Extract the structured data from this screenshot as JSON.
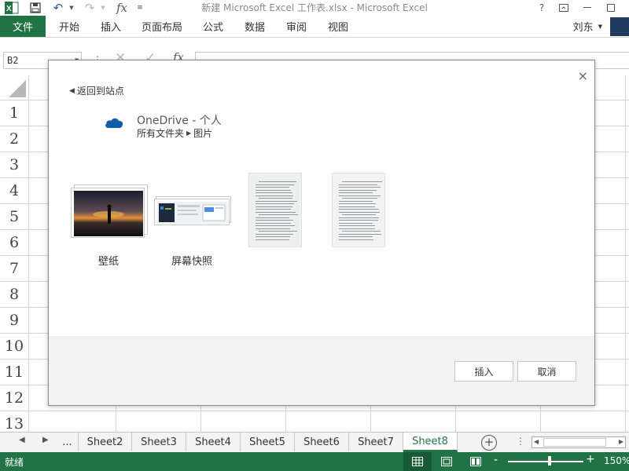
{
  "titlebar": {
    "title": "新建 Microsoft Excel 工作表.xlsx - Microsoft Excel",
    "help": "?",
    "fx": "fx"
  },
  "ribbon": {
    "file_tab": "文件",
    "tabs": [
      "开始",
      "插入",
      "页面布局",
      "公式",
      "数据",
      "审阅",
      "视图"
    ],
    "user_name": "刘东"
  },
  "formula_bar": {
    "name_box": "B2",
    "fx": "fx"
  },
  "grid": {
    "rows": [
      "1",
      "2",
      "3",
      "4",
      "5",
      "6",
      "7",
      "8",
      "9",
      "10",
      "11",
      "12",
      "13"
    ]
  },
  "dialog": {
    "back_link": "返回到站点",
    "service_name": "OneDrive - 个人",
    "path_root": "所有文件夹",
    "path_leaf": "图片",
    "items": [
      {
        "label": "壁纸",
        "type": "folder"
      },
      {
        "label": "屏幕快照",
        "type": "folder"
      },
      {
        "label": "",
        "type": "image"
      },
      {
        "label": "",
        "type": "image"
      }
    ],
    "insert_button": "插入",
    "cancel_button": "取消",
    "close": "×"
  },
  "sheet_tabs": {
    "ellipsis": "...",
    "tabs": [
      "Sheet2",
      "Sheet3",
      "Sheet4",
      "Sheet5",
      "Sheet6",
      "Sheet7",
      "Sheet8"
    ],
    "active": "Sheet8"
  },
  "status_bar": {
    "status": "就绪",
    "zoom_level": "150%",
    "zoom_minus": "-",
    "zoom_plus": "+"
  },
  "colors": {
    "accent": "#217346",
    "status_bg": "#217346",
    "grid_line": "#d4d4d4",
    "onedrive_blue": "#0f5da8"
  }
}
